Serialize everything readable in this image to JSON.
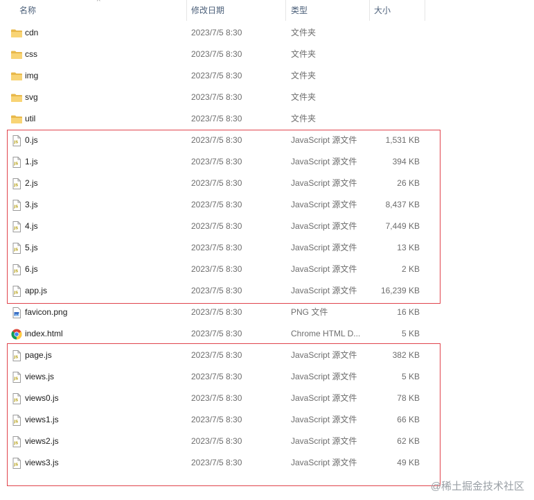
{
  "columns": {
    "name": "名称",
    "date": "修改日期",
    "type": "类型",
    "size": "大小"
  },
  "sort_indicator": "^",
  "files": [
    {
      "name": "cdn",
      "date": "2023/7/5 8:30",
      "type": "文件夹",
      "size": "",
      "icon": "folder-icon"
    },
    {
      "name": "css",
      "date": "2023/7/5 8:30",
      "type": "文件夹",
      "size": "",
      "icon": "folder-icon"
    },
    {
      "name": "img",
      "date": "2023/7/5 8:30",
      "type": "文件夹",
      "size": "",
      "icon": "folder-icon"
    },
    {
      "name": "svg",
      "date": "2023/7/5 8:30",
      "type": "文件夹",
      "size": "",
      "icon": "folder-icon"
    },
    {
      "name": "util",
      "date": "2023/7/5 8:30",
      "type": "文件夹",
      "size": "",
      "icon": "folder-icon"
    },
    {
      "name": "0.js",
      "date": "2023/7/5 8:30",
      "type": "JavaScript 源文件",
      "size": "1,531 KB",
      "icon": "js-file-icon"
    },
    {
      "name": "1.js",
      "date": "2023/7/5 8:30",
      "type": "JavaScript 源文件",
      "size": "394 KB",
      "icon": "js-file-icon"
    },
    {
      "name": "2.js",
      "date": "2023/7/5 8:30",
      "type": "JavaScript 源文件",
      "size": "26 KB",
      "icon": "js-file-icon"
    },
    {
      "name": "3.js",
      "date": "2023/7/5 8:30",
      "type": "JavaScript 源文件",
      "size": "8,437 KB",
      "icon": "js-file-icon"
    },
    {
      "name": "4.js",
      "date": "2023/7/5 8:30",
      "type": "JavaScript 源文件",
      "size": "7,449 KB",
      "icon": "js-file-icon"
    },
    {
      "name": "5.js",
      "date": "2023/7/5 8:30",
      "type": "JavaScript 源文件",
      "size": "13 KB",
      "icon": "js-file-icon"
    },
    {
      "name": "6.js",
      "date": "2023/7/5 8:30",
      "type": "JavaScript 源文件",
      "size": "2 KB",
      "icon": "js-file-icon"
    },
    {
      "name": "app.js",
      "date": "2023/7/5 8:30",
      "type": "JavaScript 源文件",
      "size": "16,239 KB",
      "icon": "js-file-icon"
    },
    {
      "name": "favicon.png",
      "date": "2023/7/5 8:30",
      "type": "PNG 文件",
      "size": "16 KB",
      "icon": "image-file-icon"
    },
    {
      "name": "index.html",
      "date": "2023/7/5 8:30",
      "type": "Chrome HTML D...",
      "size": "5 KB",
      "icon": "chrome-html-icon"
    },
    {
      "name": "page.js",
      "date": "2023/7/5 8:30",
      "type": "JavaScript 源文件",
      "size": "382 KB",
      "icon": "js-file-icon"
    },
    {
      "name": "views.js",
      "date": "2023/7/5 8:30",
      "type": "JavaScript 源文件",
      "size": "5 KB",
      "icon": "js-file-icon"
    },
    {
      "name": "views0.js",
      "date": "2023/7/5 8:30",
      "type": "JavaScript 源文件",
      "size": "78 KB",
      "icon": "js-file-icon"
    },
    {
      "name": "views1.js",
      "date": "2023/7/5 8:30",
      "type": "JavaScript 源文件",
      "size": "66 KB",
      "icon": "js-file-icon"
    },
    {
      "name": "views2.js",
      "date": "2023/7/5 8:30",
      "type": "JavaScript 源文件",
      "size": "62 KB",
      "icon": "js-file-icon"
    },
    {
      "name": "views3.js",
      "date": "2023/7/5 8:30",
      "type": "JavaScript 源文件",
      "size": "49 KB",
      "icon": "js-file-icon"
    }
  ],
  "highlight_color": "#e0434b",
  "watermark": "@稀土掘金技术社区"
}
